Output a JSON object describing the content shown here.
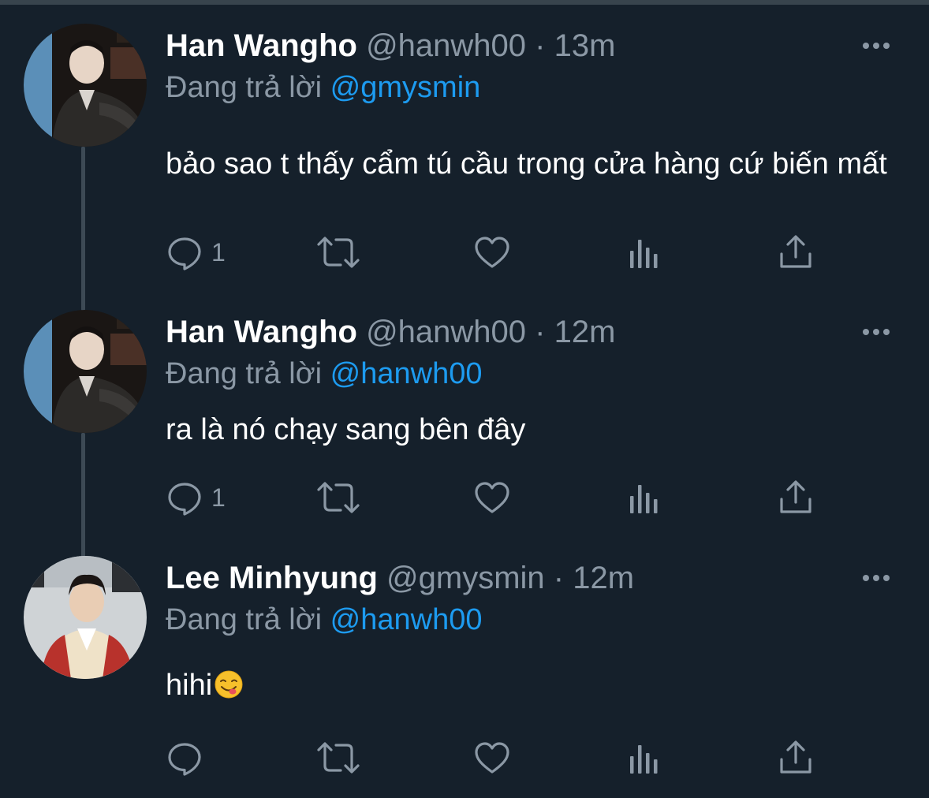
{
  "thread": [
    {
      "name": "Han Wangho",
      "handle": "@hanwh00",
      "separator": "·",
      "time": "13m",
      "reply_prefix": "Đang trả lời",
      "reply_to": "@gmysmin",
      "text": "bảo sao t thấy cẩm tú cầu trong cửa hàng cứ biến mất",
      "reply_count": "1",
      "emoji": ""
    },
    {
      "name": "Han Wangho",
      "handle": "@hanwh00",
      "separator": "·",
      "time": "12m",
      "reply_prefix": "Đang trả lời",
      "reply_to": "@hanwh00",
      "text": "ra là nó chạy sang bên đây",
      "reply_count": "1",
      "emoji": ""
    },
    {
      "name": "Lee Minhyung",
      "handle": "@gmysmin",
      "separator": "·",
      "time": "12m",
      "reply_prefix": "Đang trả lời",
      "reply_to": "@hanwh00",
      "text": "hihi",
      "reply_count": "",
      "emoji": "face-savoring-food-emoji"
    }
  ],
  "icons": {
    "reply": "reply-icon",
    "retweet": "retweet-icon",
    "like": "heart-icon",
    "views": "views-icon",
    "share": "share-icon",
    "more": "more-icon"
  },
  "colors": {
    "background": "#15202b",
    "text": "#ffffff",
    "muted": "#8b98a5",
    "link": "#1d9bf0",
    "thread_line": "#3d4a55"
  }
}
